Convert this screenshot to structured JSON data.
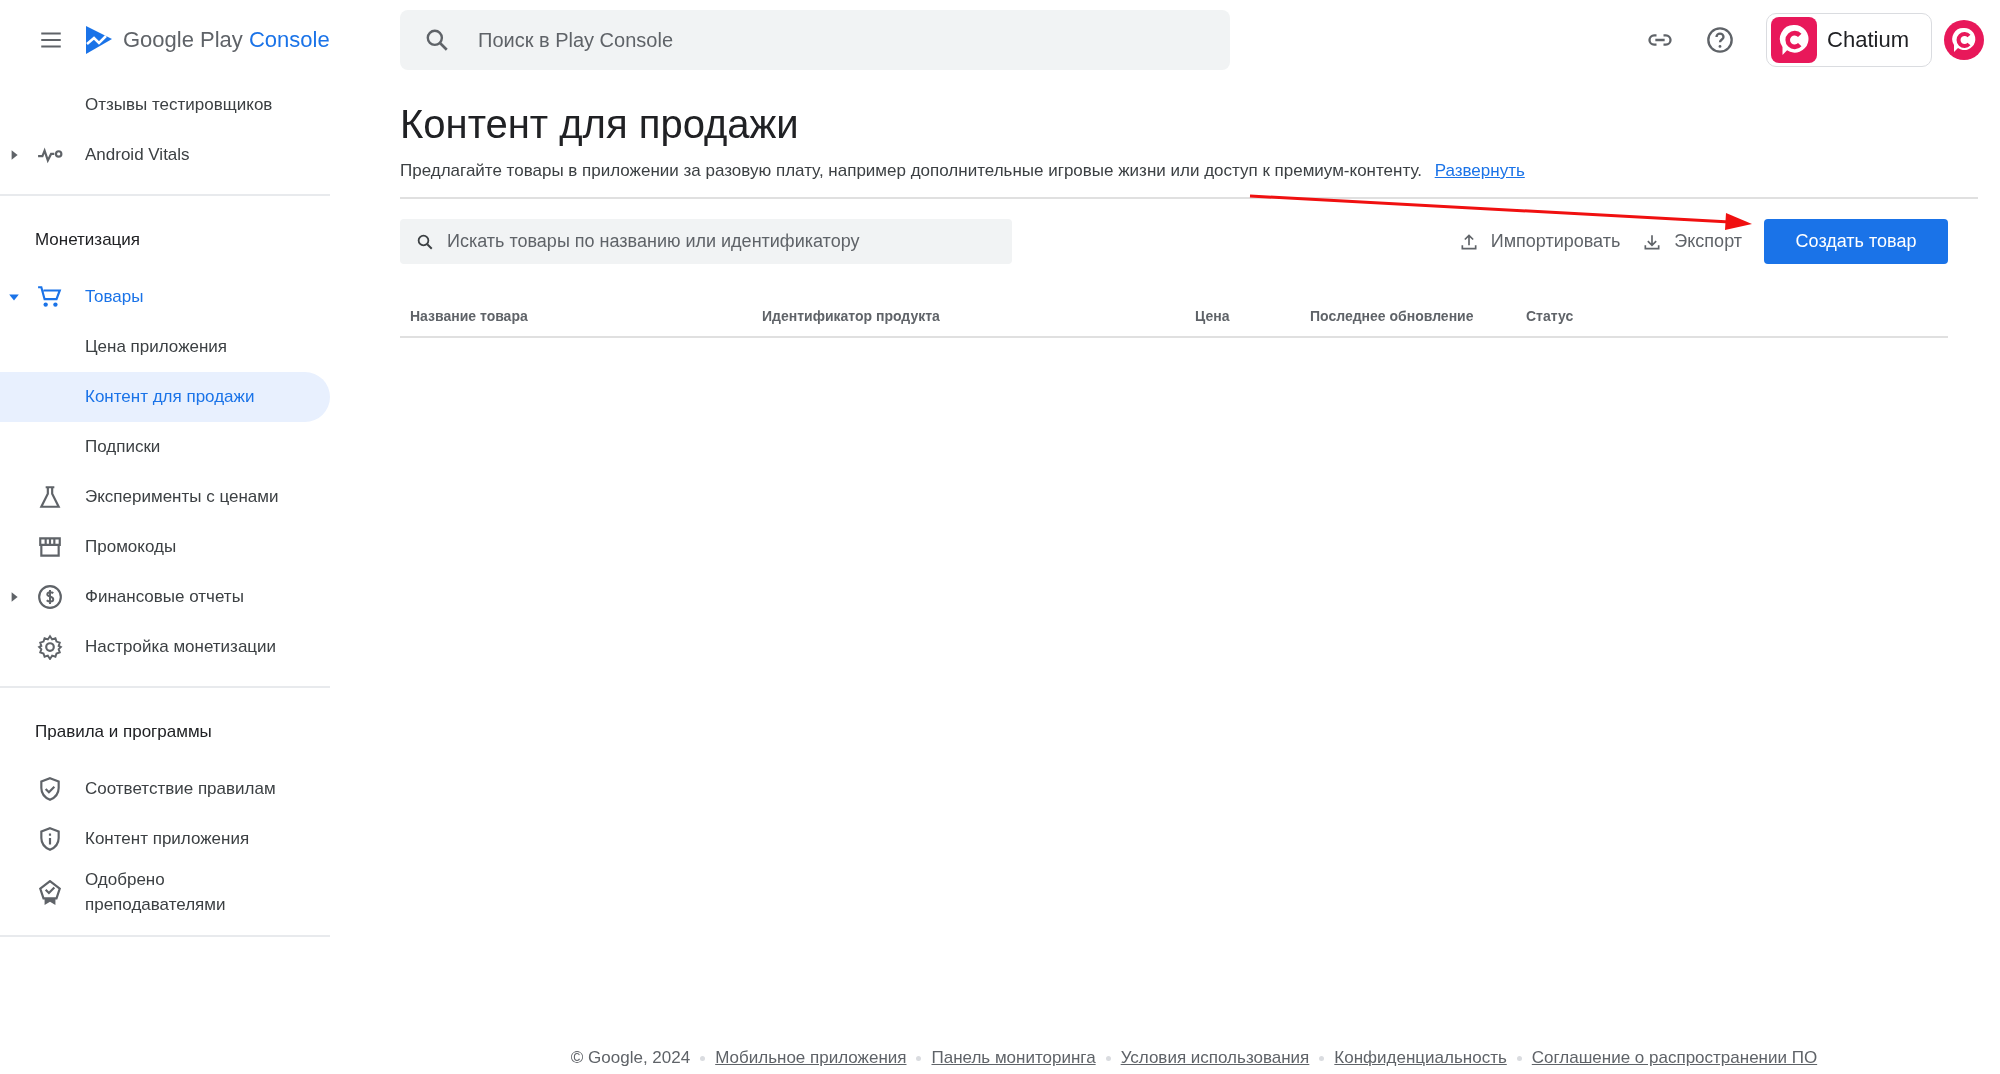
{
  "header": {
    "logo": {
      "brand": "Google Play",
      "product": "Console"
    },
    "search": {
      "placeholder": "Поиск в Play Console"
    },
    "account": {
      "name": "Chatium"
    }
  },
  "sidebar": {
    "sections": [
      {
        "items": [
          {
            "label": "Отзывы тестировщиков",
            "selected": false
          },
          {
            "label": "Android Vitals",
            "selected": false,
            "expanded": false
          }
        ]
      },
      {
        "title": "Монетизация",
        "items": [
          {
            "label": "Товары",
            "selected": false,
            "expanded": true,
            "children": [
              {
                "label": "Цена приложения",
                "selected": false
              },
              {
                "label": "Контент для продажи",
                "selected": true
              },
              {
                "label": "Подписки",
                "selected": false
              }
            ]
          },
          {
            "label": "Эксперименты с ценами",
            "selected": false
          },
          {
            "label": "Промокоды",
            "selected": false
          },
          {
            "label": "Финансовые отчеты",
            "selected": false,
            "expanded": false
          },
          {
            "label": "Настройка монетизации",
            "selected": false
          }
        ]
      },
      {
        "title": "Правила и программы",
        "items": [
          {
            "label": "Соответствие правилам",
            "selected": false
          },
          {
            "label": "Контент приложения",
            "selected": false
          },
          {
            "label": "Одобрено преподавателями",
            "selected": false
          }
        ]
      }
    ]
  },
  "page": {
    "title": "Контент для продажи",
    "description": "Предлагайте товары в приложении за разовую плату, например дополнительные игровые жизни или доступ к премиум-контенту.",
    "description_link": "Развернуть",
    "search": {
      "placeholder": "Искать товары по названию или идентификатору"
    },
    "actions": [
      {
        "label": "Импортировать",
        "kind": "upload"
      },
      {
        "label": "Экспорт",
        "kind": "download"
      }
    ],
    "primary_button": "Создать товар",
    "table": {
      "columns": [
        "Название товара",
        "Идентификатор продукта",
        "Цена",
        "Последнее обновление",
        "Статус"
      ]
    }
  },
  "footer": {
    "copyright": "© Google, 2024",
    "links": [
      "Мобильное приложения",
      "Панель мониторинга",
      "Условия использования",
      "Конфиденциальность",
      "Соглашение о распространении ПО"
    ]
  }
}
